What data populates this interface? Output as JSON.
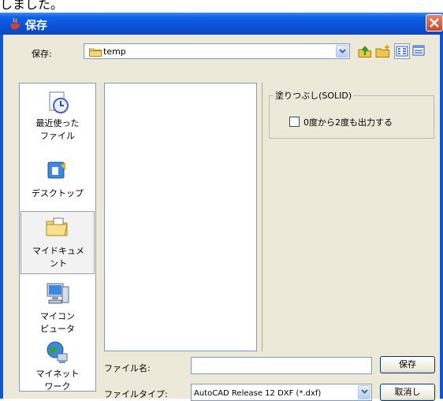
{
  "top_fragment": "しました。",
  "dialog": {
    "title": "保存"
  },
  "toolbar": {
    "save_in_label": "保存:",
    "location": "temp",
    "icons": [
      "up-folder-icon",
      "new-folder-icon",
      "list-view-icon",
      "details-view-icon"
    ]
  },
  "places": [
    {
      "icon": "recent-icon",
      "line1": "最近使った",
      "line2": "ファイル"
    },
    {
      "icon": "desktop-icon",
      "line1": "デスクトップ",
      "line2": ""
    },
    {
      "icon": "my-documents-icon",
      "line1": "マイドキュメ",
      "line2": "ント"
    },
    {
      "icon": "my-computer-icon",
      "line1": "マイコン",
      "line2": "ピュータ"
    },
    {
      "icon": "network-icon",
      "line1": "マイネット",
      "line2": "ワーク"
    }
  ],
  "options": {
    "group_title": "塗りつぶし(SOLID)",
    "checkbox_label": "0度から2度も出力する",
    "checkbox_checked": false
  },
  "footer": {
    "filename_label": "ファイル名:",
    "filename_value": "",
    "filetype_label": "ファイルタイプ:",
    "filetype_value": "AutoCAD Release 12 DXF (*.dxf)",
    "save_button": "保存",
    "cancel_button": "取消し"
  }
}
